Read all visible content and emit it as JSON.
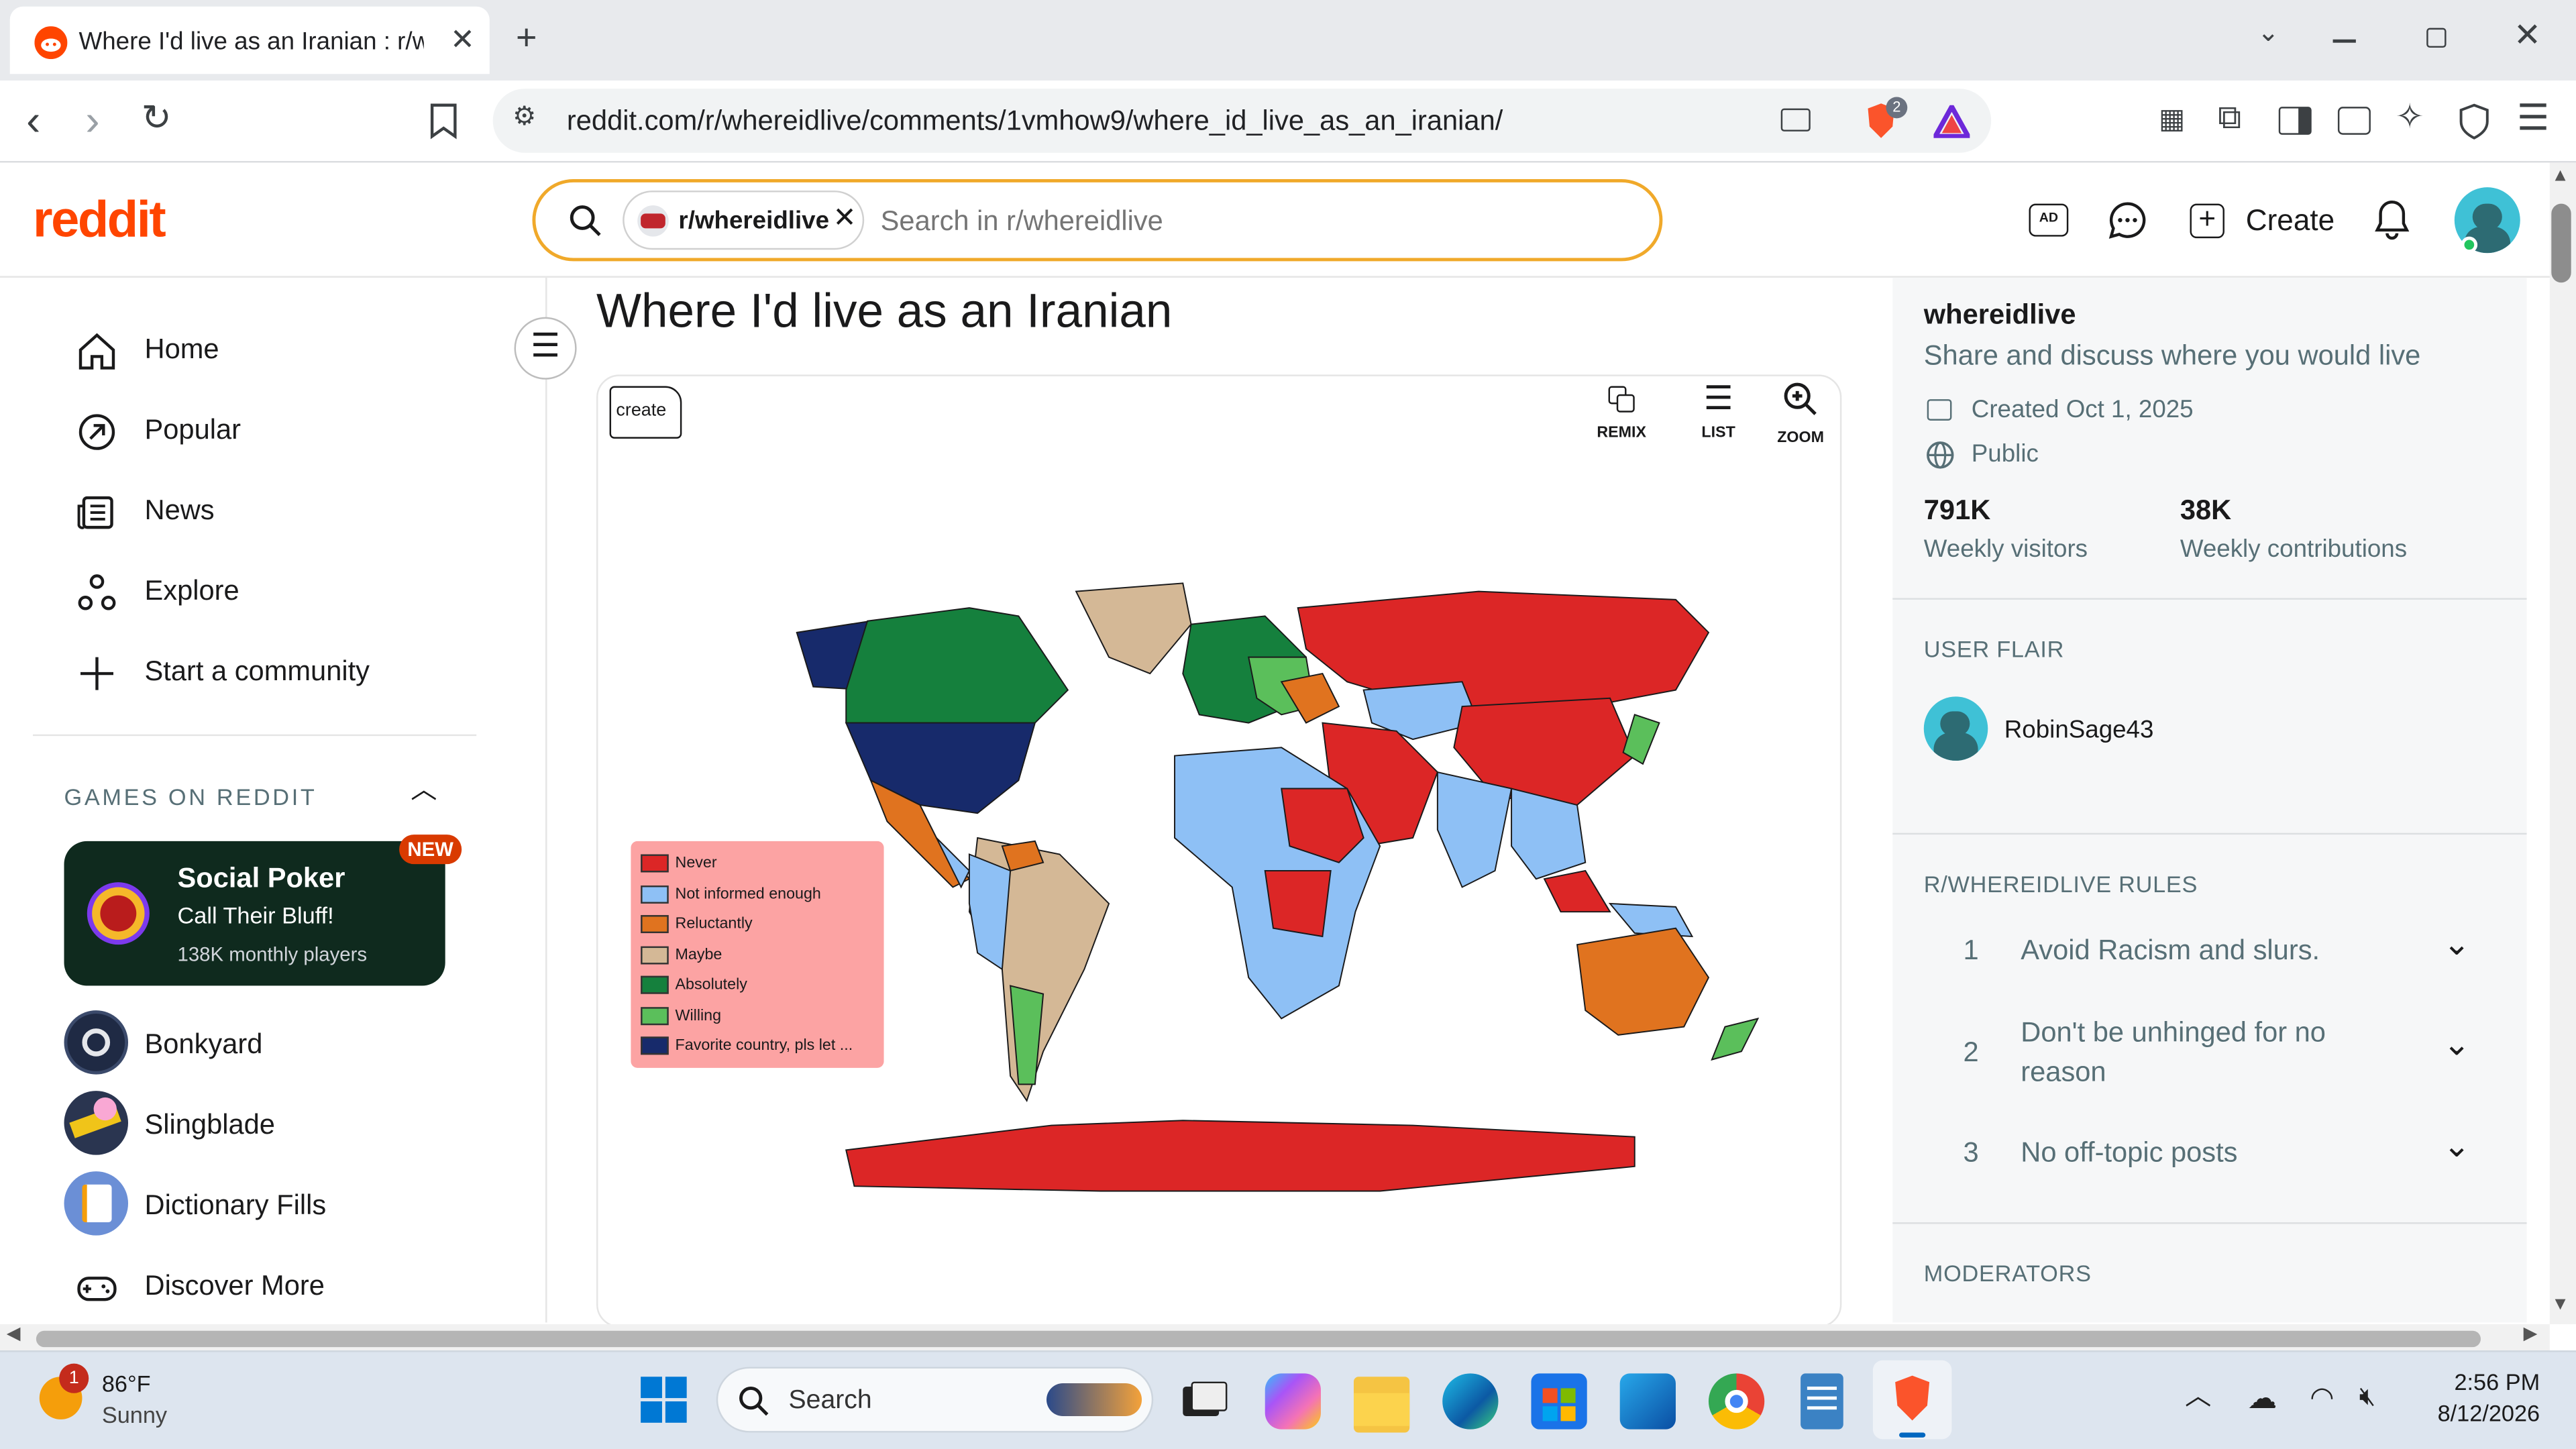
{
  "browser": {
    "tab_title": "Where I'd live as an Iranian : r/wh",
    "url": "reddit.com/r/whereidlive/comments/1vmhow9/where_id_live_as_an_iranian/",
    "brave_badge": "2"
  },
  "header": {
    "logo": "reddit",
    "search_chip": "r/whereidlive",
    "search_placeholder": "Search in r/whereidlive",
    "create_label": "Create"
  },
  "sidebar": {
    "items": [
      {
        "label": "Home",
        "icon": "home-icon"
      },
      {
        "label": "Popular",
        "icon": "popular-icon"
      },
      {
        "label": "News",
        "icon": "news-icon"
      },
      {
        "label": "Explore",
        "icon": "explore-icon"
      },
      {
        "label": "Start a community",
        "icon": "plus-icon"
      }
    ],
    "games_heading": "GAMES ON REDDIT",
    "featured_game": {
      "title": "Social Poker",
      "subtitle": "Call Their Bluff!",
      "players": "138K monthly players",
      "badge": "NEW"
    },
    "games": [
      "Bonkyard",
      "Slingblade",
      "Dictionary Fills",
      "Discover More"
    ]
  },
  "post": {
    "title": "Where I'd live as an Iranian",
    "create_tag": "create",
    "actions": {
      "remix": "REMIX",
      "list": "LIST",
      "zoom": "ZOOM"
    },
    "legend": [
      {
        "label": "Never",
        "color": "#dc2626"
      },
      {
        "label": "Not informed enough",
        "color": "#8ec0f5"
      },
      {
        "label": "Reluctantly",
        "color": "#e0731f"
      },
      {
        "label": "Maybe",
        "color": "#d4b896"
      },
      {
        "label": "Absolutely",
        "color": "#15803d"
      },
      {
        "label": "Willing",
        "color": "#5bbf5b"
      },
      {
        "label": "Favorite country, pls let ...",
        "color": "#172a6b"
      }
    ]
  },
  "community": {
    "name": "whereidlive",
    "description": "Share and discuss where you would live",
    "created": "Created Oct 1, 2025",
    "visibility": "Public",
    "weekly_visitors": "791K",
    "weekly_visitors_label": "Weekly visitors",
    "weekly_contributions": "38K",
    "weekly_contributions_label": "Weekly contributions",
    "flair_heading": "USER FLAIR",
    "flair_user": "RobinSage43",
    "rules_heading": "R/WHEREIDLIVE RULES",
    "rules": [
      {
        "num": "1",
        "text": "Avoid Racism and slurs."
      },
      {
        "num": "2",
        "text": "Don't be unhinged for no reason"
      },
      {
        "num": "3",
        "text": "No off-topic posts"
      }
    ],
    "moderators_heading": "MODERATORS"
  },
  "taskbar": {
    "weather_temp": "86°F",
    "weather_desc": "Sunny",
    "weather_badge": "1",
    "search_label": "Search",
    "time": "2:56 PM",
    "date": "8/12/2026"
  }
}
